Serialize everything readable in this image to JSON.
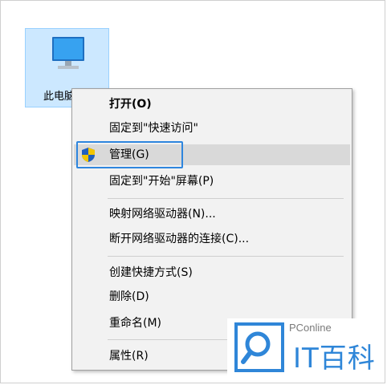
{
  "desktop": {
    "icon_label": "此电脑",
    "icon_name": "monitor-icon"
  },
  "context_menu": {
    "items": [
      {
        "label": "打开(O)",
        "bold": true
      },
      {
        "label": "固定到\"快速访问\""
      },
      {
        "label": "管理(G)",
        "icon": "uac-shield-icon",
        "highlighted": true
      },
      {
        "label": "固定到\"开始\"屏幕(P)"
      },
      {
        "label": "映射网络驱动器(N)..."
      },
      {
        "label": "断开网络驱动器的连接(C)..."
      },
      {
        "label": "创建快捷方式(S)"
      },
      {
        "label": "删除(D)"
      },
      {
        "label": "重命名(M)"
      },
      {
        "label": "属性(R)"
      }
    ]
  },
  "watermark": {
    "top_text": "PConline",
    "main_text": "IT百科",
    "icon": "search-logo-icon",
    "color": "#2f86d8"
  },
  "colors": {
    "selection_bg": "#cce8ff",
    "menu_bg": "#f2f2f2",
    "focus_border": "#2e86de"
  }
}
